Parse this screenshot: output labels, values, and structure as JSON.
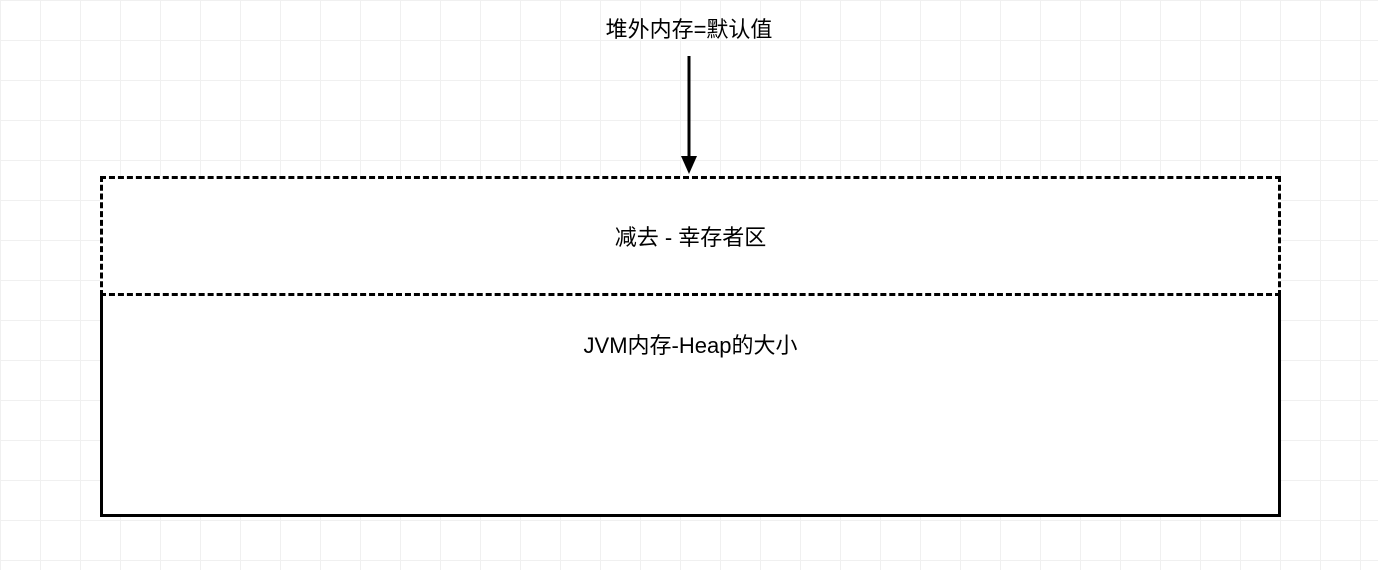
{
  "diagram": {
    "title": "堆外内存=默认值",
    "survivor_box": "减去 - 幸存者区",
    "heap_box": "JVM内存-Heap的大小"
  }
}
